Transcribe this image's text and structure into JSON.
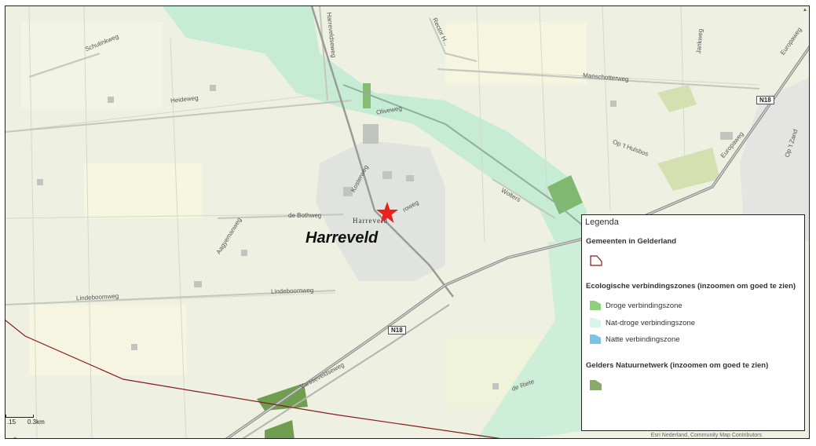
{
  "map": {
    "town_label": "Harreveld",
    "town_small_label": "Harreveld",
    "marker": "red-star-marker",
    "roads": {
      "schuttinkweg": "Schutinkweg",
      "heideweg": "Heideweg",
      "harreveldseweg": "Harreveldseweg",
      "rector": "Rector H...",
      "manschotterweg": "Manschotterweg",
      "jankweg": "Jankweg",
      "europaweg": "Europaweg",
      "op_t_hulsbos": "Op 't Hulsbos",
      "op_t_zand": "Op 't Zand",
      "oliveweg": "Oliveweg",
      "krommeweg": "Kosterweg",
      "wolters": "Wolters",
      "bothweg": "de Bothweg",
      "aaryeman": "Aagyemanweg",
      "lindeboomweg1": "Lindeboomweg",
      "lindeboomweg2": "Lindeboomweg",
      "varsseveldseweg": "Varsseveldseweg",
      "de_riete": "de Riete",
      "roweg": "roweg",
      "sweg": "weg"
    },
    "shields": {
      "n18_a": "N18",
      "n18_b": "N18"
    },
    "scale": {
      "left": ".15",
      "right": "0.3km"
    },
    "attribution": "Esri Nederland, Community Map Contributors"
  },
  "legend": {
    "title": "Legenda",
    "section_gemeenten": "Gemeenten in Gelderland",
    "section_eco": "Ecologische verbindingszones (inzoomen om goed te zien)",
    "items_eco": [
      {
        "label": "Droge verbindingszone",
        "color": "#8fce7a"
      },
      {
        "label": "Nat-droge verbindingszone",
        "color": "#d8f5ea"
      },
      {
        "label": "Natte verbindingszone",
        "color": "#7cc4e6"
      }
    ],
    "section_natuur": "Gelders Natuurnetwerk (inzoomen om goed te zien)",
    "natuur_color": "#8aa86a",
    "gemeente_color": "#8b1a1a"
  }
}
